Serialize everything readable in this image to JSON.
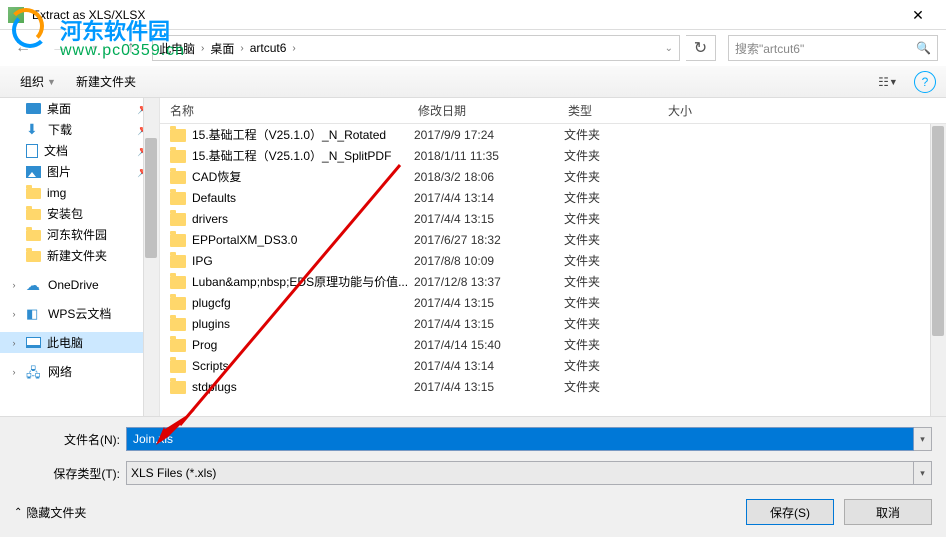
{
  "watermark": {
    "text": "河东软件园",
    "url": "www.pc0359.cn"
  },
  "window": {
    "title": "Extract as XLS/XLSX",
    "close": "✕"
  },
  "breadcrumb": {
    "items": [
      "此电脑",
      "桌面",
      "artcut6"
    ],
    "chevron": "›"
  },
  "search": {
    "placeholder": "搜索\"artcut6\""
  },
  "toolbar": {
    "organize": "组织",
    "newfolder": "新建文件夹"
  },
  "sidebar": {
    "items": [
      {
        "label": "桌面",
        "icon": "desktop",
        "pin": true
      },
      {
        "label": "下载",
        "icon": "download",
        "pin": true
      },
      {
        "label": "文档",
        "icon": "doc",
        "pin": true
      },
      {
        "label": "图片",
        "icon": "pic",
        "pin": true
      },
      {
        "label": "img",
        "icon": "folder"
      },
      {
        "label": "安装包",
        "icon": "folder"
      },
      {
        "label": "河东软件园",
        "icon": "folder"
      },
      {
        "label": "新建文件夹",
        "icon": "folder"
      },
      {
        "label": "",
        "icon": ""
      },
      {
        "label": "OneDrive",
        "icon": "onedrive",
        "arrow": ">"
      },
      {
        "label": "",
        "icon": ""
      },
      {
        "label": "WPS云文档",
        "icon": "wps",
        "arrow": ">"
      },
      {
        "label": "",
        "icon": ""
      },
      {
        "label": "此电脑",
        "icon": "pc",
        "arrow": ">",
        "selected": true
      },
      {
        "label": "",
        "icon": ""
      },
      {
        "label": "网络",
        "icon": "net",
        "arrow": ">"
      }
    ]
  },
  "columns": {
    "name": "名称",
    "date": "修改日期",
    "type": "类型",
    "size": "大小"
  },
  "files": [
    {
      "name": "15.基础工程（V25.1.0）_N_Rotated",
      "date": "2017/9/9 17:24",
      "type": "文件夹"
    },
    {
      "name": "15.基础工程（V25.1.0）_N_SplitPDF",
      "date": "2018/1/11 11:35",
      "type": "文件夹"
    },
    {
      "name": "CAD恢复",
      "date": "2018/3/2 18:06",
      "type": "文件夹"
    },
    {
      "name": "Defaults",
      "date": "2017/4/4 13:14",
      "type": "文件夹"
    },
    {
      "name": "drivers",
      "date": "2017/4/4 13:15",
      "type": "文件夹"
    },
    {
      "name": "EPPortalXM_DS3.0",
      "date": "2017/6/27 18:32",
      "type": "文件夹"
    },
    {
      "name": "IPG",
      "date": "2017/8/8 10:09",
      "type": "文件夹"
    },
    {
      "name": "Luban&amp;nbsp;EDS原理功能与价值...",
      "date": "2017/12/8 13:37",
      "type": "文件夹"
    },
    {
      "name": "plugcfg",
      "date": "2017/4/4 13:15",
      "type": "文件夹"
    },
    {
      "name": "plugins",
      "date": "2017/4/4 13:15",
      "type": "文件夹"
    },
    {
      "name": "Prog",
      "date": "2017/4/14 15:40",
      "type": "文件夹"
    },
    {
      "name": "Scripts",
      "date": "2017/4/4 13:14",
      "type": "文件夹"
    },
    {
      "name": "stdplugs",
      "date": "2017/4/4 13:15",
      "type": "文件夹"
    }
  ],
  "filename": {
    "label": "文件名(N):",
    "value": "Join.xls"
  },
  "filetype": {
    "label": "保存类型(T):",
    "value": "XLS Files (*.xls)"
  },
  "footer": {
    "expand": "隐藏文件夹",
    "save": "保存(S)",
    "cancel": "取消"
  }
}
